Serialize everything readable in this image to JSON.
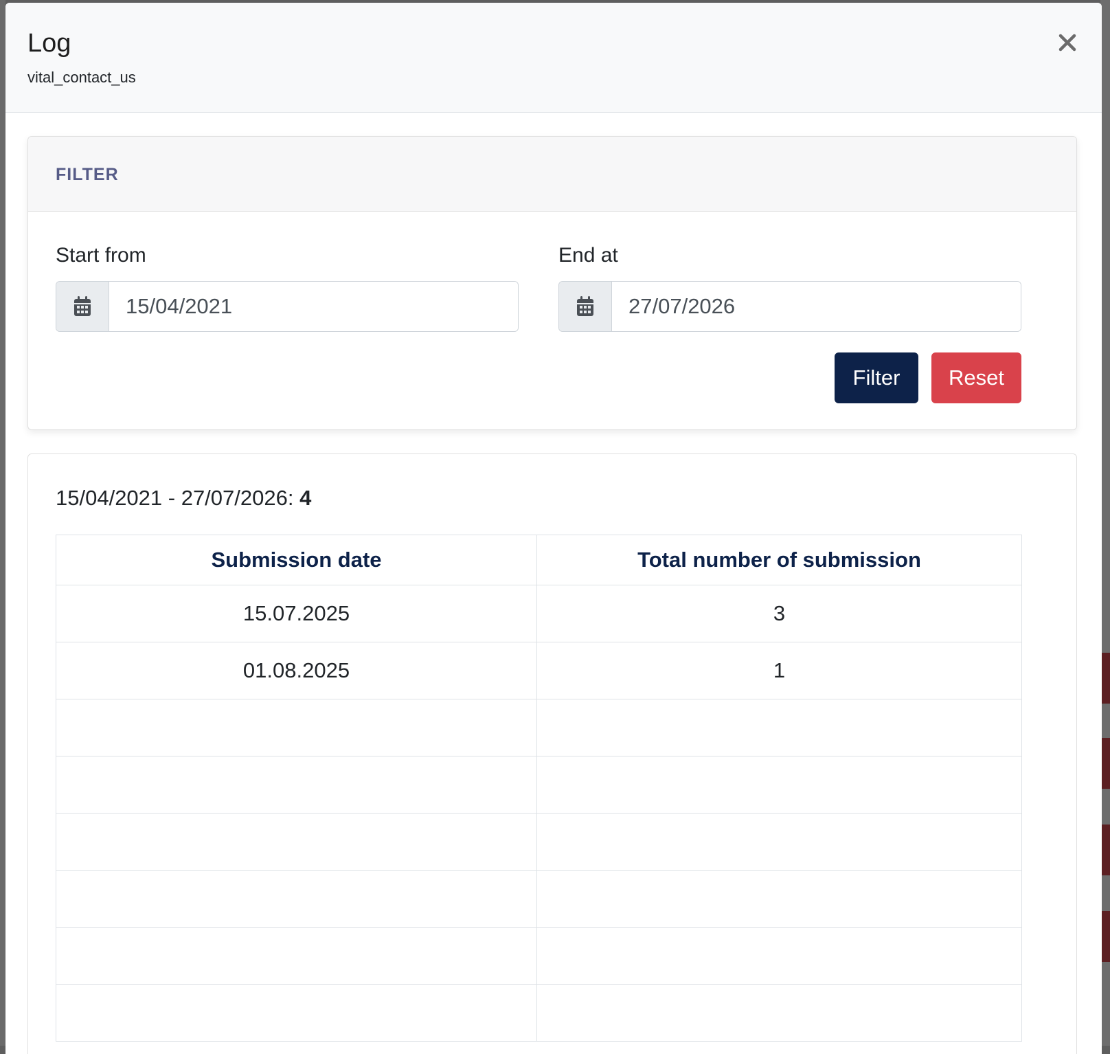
{
  "modal": {
    "title": "Log",
    "subtitle": "vital_contact_us",
    "close_label": "×"
  },
  "filter": {
    "section_title": "FILTER",
    "start_label": "Start from",
    "start_value": "15/04/2021",
    "end_label": "End at",
    "end_value": "27/07/2026",
    "filter_button": "Filter",
    "reset_button": "Reset"
  },
  "results": {
    "range_text": "15/04/2021 - 27/07/2026:",
    "total": "4",
    "table": {
      "columns": [
        "Submission date",
        "Total number of submission"
      ],
      "rows": [
        [
          "15.07.2025",
          "3"
        ],
        [
          "01.08.2025",
          "1"
        ],
        [
          "",
          ""
        ],
        [
          "",
          ""
        ],
        [
          "",
          ""
        ],
        [
          "",
          ""
        ],
        [
          "",
          ""
        ],
        [
          "",
          ""
        ]
      ]
    }
  },
  "colors": {
    "primary": "#0d2249",
    "danger": "#d9424b",
    "filter_title": "#565b87"
  },
  "icons": {
    "calendar": "calendar-icon",
    "close": "close-icon"
  }
}
